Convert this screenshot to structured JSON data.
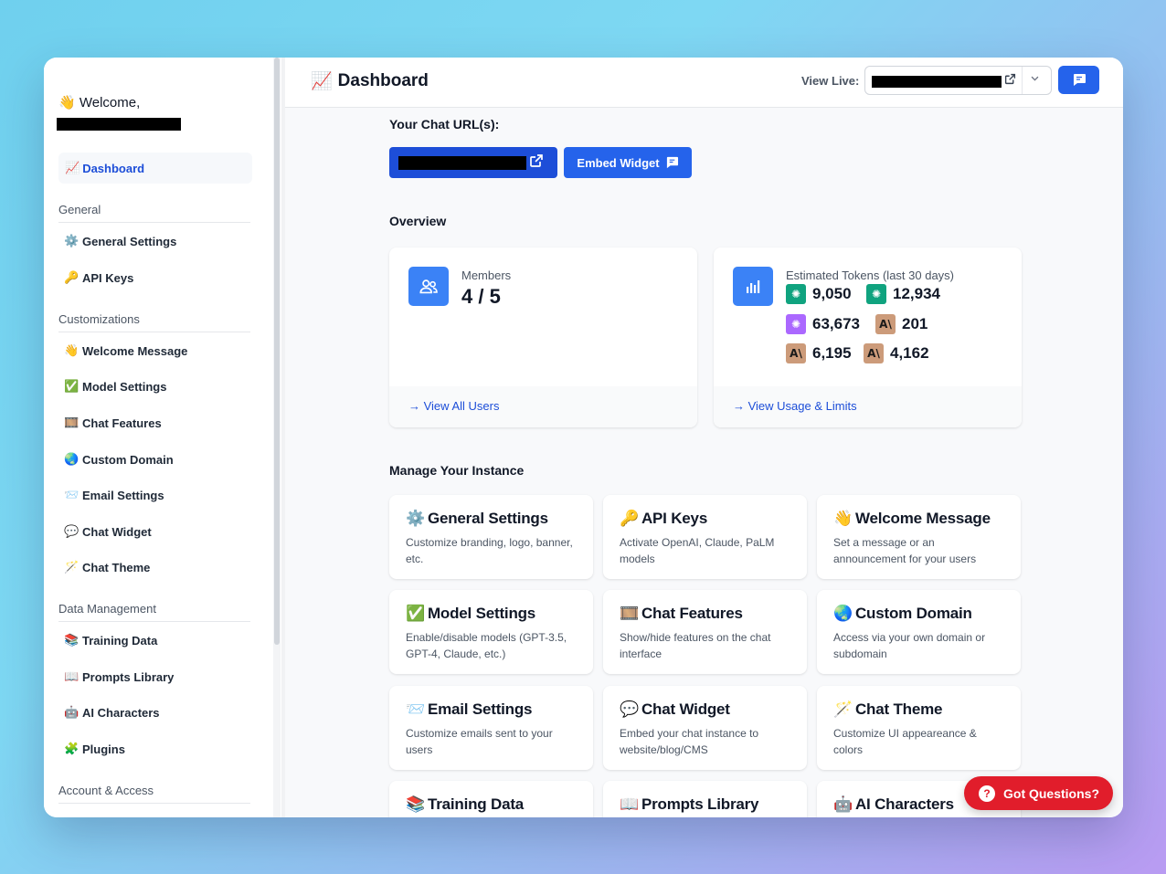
{
  "sidebar": {
    "welcome": "Welcome,",
    "welcome_emoji": "👋",
    "active": {
      "emoji": "📈",
      "label": "Dashboard"
    },
    "sections": [
      {
        "title": "General",
        "items": [
          {
            "emoji": "⚙️",
            "label": "General Settings"
          },
          {
            "emoji": "🔑",
            "label": "API Keys"
          }
        ]
      },
      {
        "title": "Customizations",
        "items": [
          {
            "emoji": "👋",
            "label": "Welcome Message"
          },
          {
            "emoji": "✅",
            "label": "Model Settings"
          },
          {
            "emoji": "🎞️",
            "label": "Chat Features"
          },
          {
            "emoji": "🌏",
            "label": "Custom Domain"
          },
          {
            "emoji": "📨",
            "label": "Email Settings"
          },
          {
            "emoji": "💬",
            "label": "Chat Widget"
          },
          {
            "emoji": "🪄",
            "label": "Chat Theme"
          }
        ]
      },
      {
        "title": "Data Management",
        "items": [
          {
            "emoji": "📚",
            "label": "Training Data"
          },
          {
            "emoji": "📖",
            "label": "Prompts Library"
          },
          {
            "emoji": "🤖",
            "label": "AI Characters"
          },
          {
            "emoji": "🧩",
            "label": "Plugins"
          }
        ]
      },
      {
        "title": "Account & Access",
        "items": []
      }
    ]
  },
  "header": {
    "emoji": "📈",
    "title": "Dashboard",
    "view_live_label": "View Live:"
  },
  "chat_url": {
    "label": "Your Chat URL(s):",
    "embed_label": "Embed Widget"
  },
  "overview": {
    "label": "Overview",
    "members": {
      "label": "Members",
      "value": "4 / 5",
      "link": "→ View All Users"
    },
    "tokens": {
      "label": "Estimated Tokens (last 30 days)",
      "rows": [
        [
          {
            "badge": "gpt",
            "value": "9,050"
          },
          {
            "badge": "gpt",
            "value": "12,934"
          }
        ],
        [
          {
            "badge": "gpt4",
            "value": "63,673"
          },
          {
            "badge": "anth",
            "value": "201"
          }
        ],
        [
          {
            "badge": "anth",
            "value": "6,195"
          },
          {
            "badge": "anth",
            "value": "4,162"
          }
        ]
      ],
      "link": "→ View Usage & Limits"
    }
  },
  "manage": {
    "label": "Manage Your Instance",
    "tiles": [
      {
        "emoji": "⚙️",
        "title": "General Settings",
        "desc": "Customize branding, logo, banner, etc."
      },
      {
        "emoji": "🔑",
        "title": "API Keys",
        "desc": "Activate OpenAI, Claude, PaLM models"
      },
      {
        "emoji": "👋",
        "title": "Welcome Message",
        "desc": "Set a message or an announcement for your users"
      },
      {
        "emoji": "✅",
        "title": "Model Settings",
        "desc": "Enable/disable models (GPT-3.5, GPT-4, Claude, etc.)"
      },
      {
        "emoji": "🎞️",
        "title": "Chat Features",
        "desc": "Show/hide features on the chat interface"
      },
      {
        "emoji": "🌏",
        "title": "Custom Domain",
        "desc": "Access via your own domain or subdomain"
      },
      {
        "emoji": "📨",
        "title": "Email Settings",
        "desc": "Customize emails sent to your users"
      },
      {
        "emoji": "💬",
        "title": "Chat Widget",
        "desc": "Embed your chat instance to website/blog/CMS"
      },
      {
        "emoji": "🪄",
        "title": "Chat Theme",
        "desc": "Customize UI appeareance & colors"
      },
      {
        "emoji": "📚",
        "title": "Training Data",
        "desc": ""
      },
      {
        "emoji": "📖",
        "title": "Prompts Library",
        "desc": ""
      },
      {
        "emoji": "🤖",
        "title": "AI Characters",
        "desc": ""
      }
    ]
  },
  "help": {
    "label": "Got Questions?",
    "icon": "?"
  },
  "colors": {
    "accent": "#2563eb",
    "accent_dark": "#1d4ed8",
    "help": "#e11d2b"
  }
}
